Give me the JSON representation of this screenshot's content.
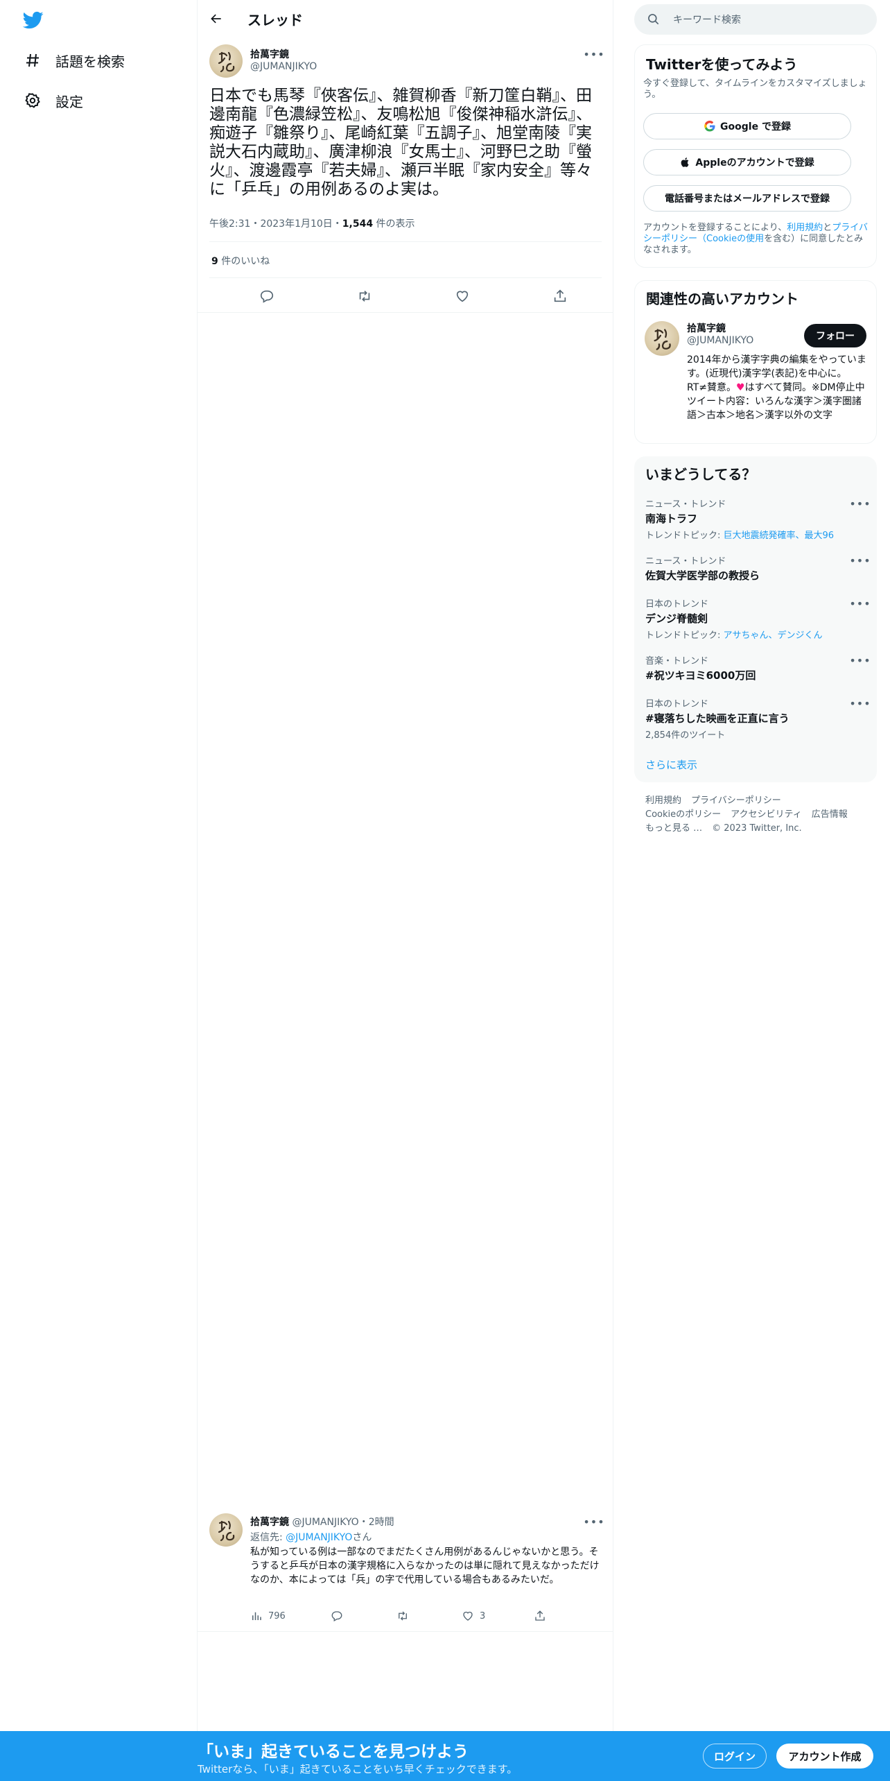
{
  "nav": {
    "explore_label": "話題を検索",
    "settings_label": "設定"
  },
  "header": {
    "title": "スレッド"
  },
  "main_tweet": {
    "author_name": "拾萬字鏡",
    "author_handle": "@JUMANJIKYO",
    "text": "日本でも馬琴『俠客伝』、雑賀柳香『新刀筐白鞘』、田邊南龍『色濃緑笠松』、友鳴松旭『俊傑神稲水滸伝』、痴遊子『雛祭り』、尾崎紅葉『五調子』、旭堂南陵『実説大石内蔵助』、廣津柳浪『女馬士』、河野巳之助『螢火』、渡邊霞亭『若夫婦』、瀬戸半眠『家内安全』等々に「乒乓」の用例あるのよ実は。",
    "meta_time": "午後2:31・2023年1月10日・",
    "views_count": "1,544",
    "views_label": " 件の表示",
    "likes_count": "9",
    "likes_label": " 件のいいね"
  },
  "reply": {
    "author_name": "拾萬字鏡",
    "author_handle": "@JUMANJIKYO",
    "time": "・2時間",
    "reply_prefix": "返信先: ",
    "reply_handle": "@JUMANJIKYO",
    "reply_suffix": "さん",
    "text": "私が知っている例は一部なのでまだたくさん用例があるんじゃないかと思う。そうすると乒乓が日本の漢字規格に入らなかったのは単に隠れて見えなかっただけなのか、本によっては「兵」の字で代用している場合もあるみたいだ。",
    "views": "796",
    "likes": "3"
  },
  "search": {
    "placeholder": "キーワード検索"
  },
  "signup_card": {
    "title": "Twitterを使ってみよう",
    "subtitle": "今すぐ登録して、タイムラインをカスタマイズしましょう。",
    "google_label": "Google で登録",
    "apple_label": "Appleのアカウントで登録",
    "phone_label": "電話番号またはメールアドレスで登録",
    "legal_1": "アカウントを登録することにより、",
    "legal_terms": "利用規約",
    "legal_2": "と",
    "legal_privacy": "プライバシーポリシー（Cookieの使用",
    "legal_3": "を含む）に同意したとみなされます。"
  },
  "related_card": {
    "title": "関連性の高いアカウント",
    "name": "拾萬字鏡",
    "handle": "@JUMANJIKYO",
    "follow_label": "フォロー",
    "bio_1": "2014年から漢字字典の編集をやっています。(近現代)漢字学(表記)を中心に。 RT≠賛意。",
    "bio_heart": "♥",
    "bio_2": "はすべて賛同。※DM停止中 ツイート内容：いろんな漢字＞漢字圏諸語＞古本＞地名＞漢字以外の文字"
  },
  "trends_card": {
    "title": "いまどうしてる？",
    "items": [
      {
        "category": "ニュース・トレンド",
        "name": "南海トラフ",
        "sub_prefix": "トレンドトピック: ",
        "sub_links": "巨大地震続発確率、最大96"
      },
      {
        "category": "ニュース・トレンド",
        "name": "佐賀大学医学部の教授ら",
        "sub_prefix": "",
        "sub_links": ""
      },
      {
        "category": "日本のトレンド",
        "name": "デンジ脊髄剣",
        "sub_prefix": "トレンドトピック: ",
        "sub_links": "アサちゃん、デンジくん"
      },
      {
        "category": "音楽・トレンド",
        "name": "#祝ツキヨミ6000万回",
        "sub_prefix": "",
        "sub_links": ""
      },
      {
        "category": "日本のトレンド",
        "name": "#寝落ちした映画を正直に言う",
        "sub_prefix": "2,854件のツイート",
        "sub_links": ""
      }
    ],
    "show_more": "さらに表示"
  },
  "footer": {
    "terms": "利用規約",
    "privacy": "プライバシーポリシー",
    "cookie": "Cookieのポリシー",
    "accessibility": "アクセシビリティ",
    "ads": "広告情報",
    "more": "もっと見る …",
    "copyright": "© 2023 Twitter, Inc."
  },
  "bottom_bar": {
    "title": "「いま」起きていることを見つけよう",
    "subtitle": "Twitterなら、「いま」起きていることをいち早くチェックできます。",
    "login_label": "ログイン",
    "signup_label": "アカウント作成"
  },
  "colors": {
    "accent": "#1d9bf0",
    "text": "#0f1419",
    "muted": "#536471",
    "heart": "#f91880"
  }
}
